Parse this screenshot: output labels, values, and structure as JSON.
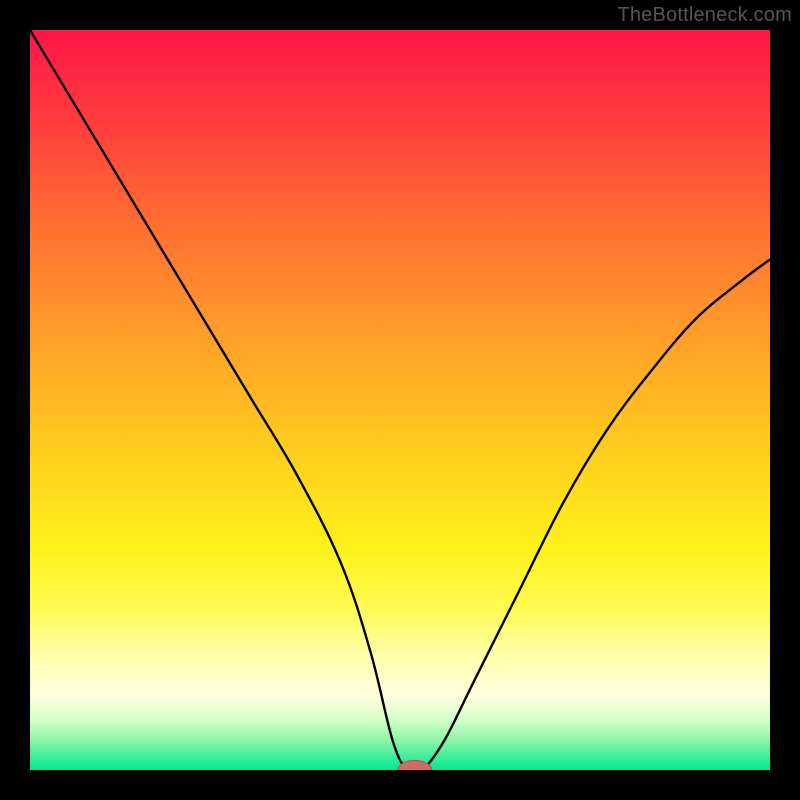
{
  "watermark": "TheBottleneck.com",
  "colors": {
    "frame": "#000000",
    "curve": "#000000",
    "marker_fill": "#d26a6a",
    "marker_stroke": "#b85454",
    "gradient_stops": [
      {
        "offset": 0.0,
        "color": "#ff1646"
      },
      {
        "offset": 0.12,
        "color": "#ff3b3d"
      },
      {
        "offset": 0.25,
        "color": "#ff6a33"
      },
      {
        "offset": 0.4,
        "color": "#ff9a2a"
      },
      {
        "offset": 0.55,
        "color": "#ffc81f"
      },
      {
        "offset": 0.7,
        "color": "#fff21a"
      },
      {
        "offset": 0.78,
        "color": "#fffb50"
      },
      {
        "offset": 0.85,
        "color": "#ffffb0"
      },
      {
        "offset": 0.9,
        "color": "#ffffe0"
      },
      {
        "offset": 0.93,
        "color": "#d8ffca"
      },
      {
        "offset": 0.96,
        "color": "#8cf5a8"
      },
      {
        "offset": 1.0,
        "color": "#00e88f"
      }
    ]
  },
  "chart_data": {
    "type": "line",
    "title": "",
    "xlabel": "",
    "ylabel": "",
    "xlim": [
      0,
      100
    ],
    "ylim": [
      0,
      100
    ],
    "legend": false,
    "grid": false,
    "annotations": [
      {
        "text": "TheBottleneck.com",
        "position": "top-right"
      }
    ],
    "series": [
      {
        "name": "bottleneck-curve",
        "x": [
          0,
          6,
          12,
          18,
          24,
          30,
          36,
          42,
          46,
          49,
          51,
          53,
          56,
          60,
          66,
          72,
          78,
          84,
          90,
          96,
          100
        ],
        "values": [
          100,
          90,
          80,
          70,
          60,
          50,
          40,
          28,
          16,
          4,
          0,
          0,
          4,
          12,
          24,
          36,
          46,
          54,
          61,
          66,
          69
        ]
      }
    ],
    "marker": {
      "x": 52,
      "y": 0,
      "rx": 2.3,
      "ry": 1.3
    }
  }
}
